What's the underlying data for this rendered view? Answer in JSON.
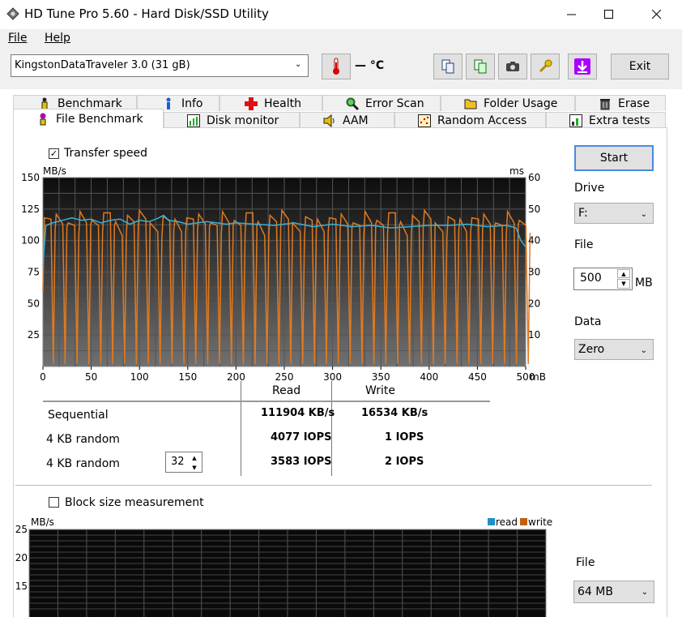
{
  "window": {
    "title": "HD Tune Pro 5.60 - Hard Disk/SSD Utility"
  },
  "menu": {
    "file": "File",
    "help": "Help"
  },
  "toolbar": {
    "drive": "KingstonDataTraveler 3.0 (31 gB)",
    "temperature": "— °C",
    "exit_label": "Exit"
  },
  "tabs_top": [
    "Benchmark",
    "Info",
    "Health",
    "Error Scan",
    "Folder Usage",
    "Erase"
  ],
  "tabs_bottom": [
    "File Benchmark",
    "Disk monitor",
    "AAM",
    "Random Access",
    "Extra tests"
  ],
  "controls": {
    "transfer_speed_label": "Transfer speed",
    "transfer_speed_checked": true,
    "start_label": "Start",
    "drive_label": "Drive",
    "drive_value": "F:",
    "file_label": "File",
    "file_value": "500",
    "file_unit": "MB",
    "data_label": "Data",
    "data_value": "Zero",
    "block_size_label": "Block size measurement",
    "block_size_checked": false,
    "file2_label": "File",
    "file2_value": "64 MB",
    "queue_depth": "32"
  },
  "results": {
    "read_header": "Read",
    "write_header": "Write",
    "rows": [
      {
        "label": "Sequential",
        "read": "111904 KB/s",
        "write": "16534 KB/s"
      },
      {
        "label": "4 KB random",
        "read": "4077 IOPS",
        "write": "1 IOPS"
      },
      {
        "label": "4 KB random",
        "read": "3583 IOPS",
        "write": "2 IOPS"
      }
    ]
  },
  "chart_data": [
    {
      "type": "line",
      "xlabel": "",
      "x_unit": "mB",
      "y_unit_left": "MB/s",
      "y_unit_right": "ms",
      "xlim": [
        0,
        500
      ],
      "ylim": [
        0,
        150
      ],
      "ylim_right": [
        0,
        60
      ],
      "x_ticks": [
        0,
        50,
        100,
        150,
        200,
        250,
        300,
        350,
        400,
        450,
        500
      ],
      "y_ticks": [
        25,
        50,
        75,
        100,
        125,
        150
      ],
      "y_ticks_right": [
        10,
        20,
        30,
        40,
        50,
        60
      ],
      "grid": true,
      "series": [
        {
          "color": "#3ab0d8",
          "x": [
            0,
            3,
            10,
            20,
            30,
            40,
            50,
            60,
            70,
            80,
            90,
            100,
            110,
            120,
            125,
            130,
            140,
            150,
            160,
            170,
            180,
            190,
            200,
            220,
            240,
            260,
            280,
            300,
            320,
            340,
            360,
            380,
            400,
            420,
            440,
            460,
            480,
            490,
            495,
            500
          ],
          "y": [
            80,
            112,
            114,
            116,
            118,
            116,
            117,
            114,
            116,
            117,
            113,
            116,
            115,
            118,
            120,
            116,
            115,
            113,
            114,
            115,
            114,
            113,
            114,
            113,
            112,
            114,
            111,
            113,
            111,
            112,
            110,
            111,
            112,
            112,
            113,
            111,
            112,
            110,
            100,
            95
          ]
        },
        {
          "color": "#e07a20",
          "pattern": "write burst oscillation",
          "y_high": 118,
          "y_low": 2,
          "period_mb": 12.3
        }
      ]
    },
    {
      "type": "bar",
      "y_unit": "MB/s",
      "ylim": [
        10,
        25
      ],
      "y_ticks": [
        15,
        20,
        25
      ],
      "legend": [
        "read",
        "write"
      ],
      "legend_colors": [
        "#1e90c8",
        "#c0600e"
      ],
      "legend_position": "top-right",
      "grid": true,
      "series": []
    }
  ]
}
